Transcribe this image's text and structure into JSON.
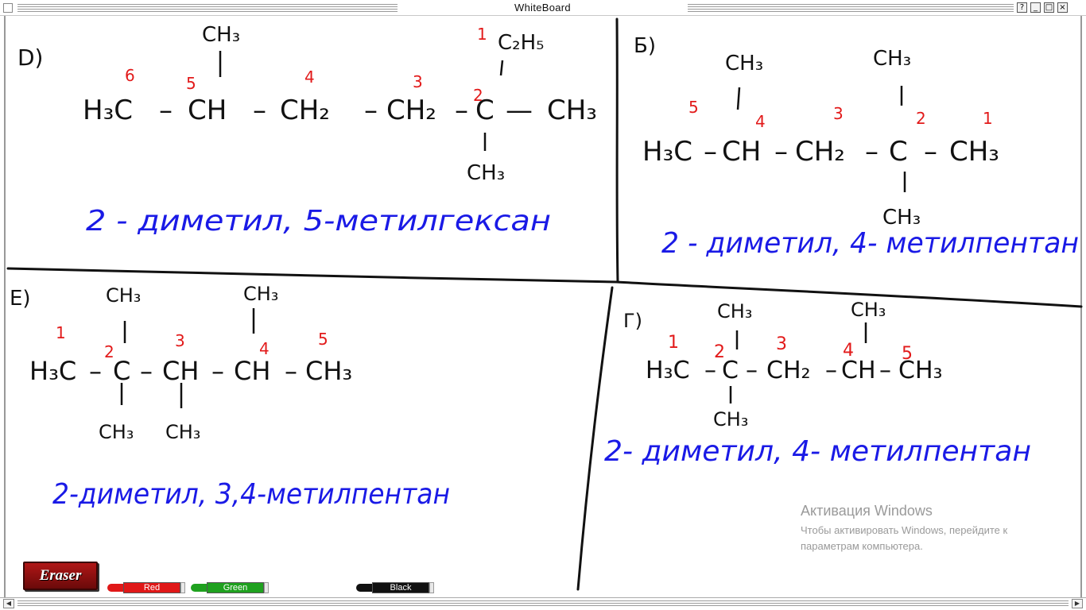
{
  "window": {
    "title": "WhiteBoard",
    "buttons": {
      "help": "?",
      "minimize": "_",
      "maximize": "□",
      "close": "×"
    }
  },
  "problems": [
    {
      "label": "D)",
      "formula": {
        "main": [
          "H₃C",
          "–",
          "CH",
          "–",
          "CH₂",
          "–",
          "CH₂",
          "–",
          "C",
          "—",
          "CH₃"
        ],
        "subst_top": [
          "CH₃",
          "C₂H₅"
        ],
        "subst_bottom": [
          "CH₃"
        ]
      },
      "numbers": [
        "6",
        "5",
        "4",
        "3",
        "2",
        "1"
      ],
      "name": "2 - диметил, 5-метилгексан"
    },
    {
      "label": "Б)",
      "formula": {
        "main": [
          "H₃C",
          "–",
          "CH",
          "–",
          "CH₂",
          "–",
          "C",
          "–",
          "CH₃"
        ],
        "subst_top": [
          "CH₃",
          "CH₃"
        ],
        "subst_bottom": [
          "CH₃"
        ]
      },
      "numbers": [
        "5",
        "4",
        "3",
        "2",
        "1"
      ],
      "name": "2 - диметил, 4- метилпентан"
    },
    {
      "label": "Е)",
      "formula": {
        "main": [
          "H₃C",
          "–",
          "C",
          "–",
          "CH",
          "–",
          "CH",
          "–",
          "CH₃"
        ],
        "subst_top": [
          "CH₃",
          "CH₃"
        ],
        "subst_bottom": [
          "CH₃",
          "CH₃"
        ]
      },
      "numbers": [
        "1",
        "2",
        "3",
        "4",
        "5"
      ],
      "name": "2-диметил, 3,4-метилпентан"
    },
    {
      "label": "Г)",
      "formula": {
        "main": [
          "H₃C",
          "–",
          "C",
          "–",
          "CH₂",
          "–",
          "CH",
          "–",
          "CH₃"
        ],
        "subst_top": [
          "CH₃",
          "CH₃"
        ],
        "subst_bottom": [
          "CH₃"
        ]
      },
      "numbers": [
        "1",
        "2",
        "3",
        "4",
        "5"
      ],
      "name": "2- диметил, 4- метилпентан"
    }
  ],
  "toolbar": {
    "eraser": "Eraser",
    "markers": [
      {
        "label": "Red",
        "color": "#e01818"
      },
      {
        "label": "Green",
        "color": "#1fa11f"
      },
      {
        "label": "Black",
        "color": "#111111"
      }
    ]
  },
  "activation": {
    "title": "Активация Windows",
    "body": "Чтобы активировать Windows, перейдите к параметрам компьютера."
  },
  "colors": {
    "ink_black": "#111111",
    "ink_red": "#e21a1a",
    "ink_blue": "#1a1ae6"
  }
}
